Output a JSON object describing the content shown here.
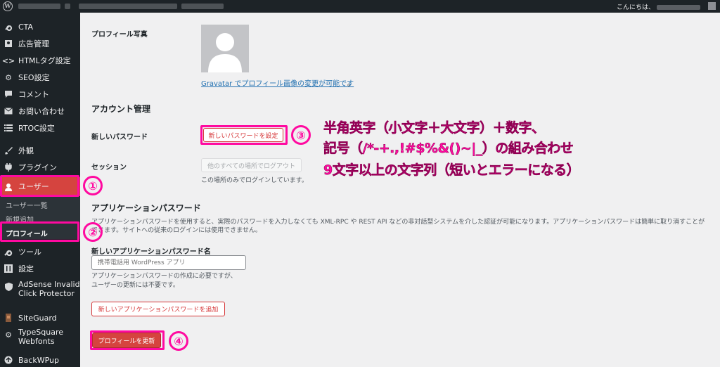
{
  "admin_bar": {
    "greeting": "こんにちは、"
  },
  "sidebar": {
    "items": [
      {
        "label": "CTA",
        "icon": "wrench-icon"
      },
      {
        "label": "広告管理",
        "icon": "ad-icon"
      },
      {
        "label": "HTMLタグ設定",
        "icon": "code-icon"
      },
      {
        "label": "SEO設定",
        "icon": "gear-icon"
      },
      {
        "label": "コメント",
        "icon": "comment-icon"
      },
      {
        "label": "お問い合わせ",
        "icon": "mail-icon"
      },
      {
        "label": "RTOC設定",
        "icon": "list-icon"
      },
      {
        "label": "外観",
        "icon": "brush-icon"
      },
      {
        "label": "プラグイン",
        "icon": "plugin-icon"
      },
      {
        "label": "ユーザー",
        "icon": "user-icon"
      },
      {
        "label": "ツール",
        "icon": "tool-icon"
      },
      {
        "label": "設定",
        "icon": "settings-icon"
      },
      {
        "label": "AdSense Invalid Click Protector",
        "icon": "shield-icon"
      },
      {
        "label": "SiteGuard",
        "icon": "guard-icon"
      },
      {
        "label": "TypeSquare Webfonts",
        "icon": "gear-icon"
      },
      {
        "label": "BackWPup",
        "icon": "backup-icon"
      }
    ],
    "submenu": [
      {
        "label": "ユーザー一覧"
      },
      {
        "label": "新規追加"
      },
      {
        "label": "プロフィール"
      }
    ]
  },
  "profile": {
    "photo_label": "プロフィール写真",
    "gravatar_link": "Gravatar でプロフィール画像の変更が可能です",
    "gravatar_suffix": "。"
  },
  "account": {
    "title": "アカウント管理",
    "new_password_label": "新しいパスワード",
    "set_password_button": "新しいパスワードを設定",
    "session_label": "セッション",
    "logout_elsewhere_button": "他のすべての場所でログアウト",
    "session_desc": "この場所のみでログインしています。"
  },
  "app_passwords": {
    "title": "アプリケーションパスワード",
    "description": "アプリケーションパスワードを使用すると、実際のパスワードを入力しなくても XML-RPC や REST API などの非対話型システムを介した認証が可能になります。アプリケーションパスワードは簡単に取り消すことができます。サイトへの従来のログインには使用できません。",
    "name_label": "新しいアプリケーションパスワード名",
    "name_placeholder": "携帯電話用 WordPress アプリ",
    "help_line1": "アプリケーションパスワードの作成に必要ですが、",
    "help_line2": "ユーザーの更新には不要です。",
    "add_button": "新しいアプリケーションパスワードを追加"
  },
  "update_button": "プロフィールを更新",
  "annotations": {
    "markers": [
      "①",
      "②",
      "③",
      "④"
    ],
    "note_line1": "半角英字（小文字＋大文字）＋数字、",
    "note_line2": "記号（/*-+.,!#$%&()~|_）の組み合わせ",
    "note_line3": "9文字以上の文字列（短いとエラーになる）"
  },
  "colors": {
    "accent": "#d5443f",
    "highlight": "#ff0aa0",
    "link": "#2271b1",
    "sidebar_bg": "#1d2327"
  }
}
